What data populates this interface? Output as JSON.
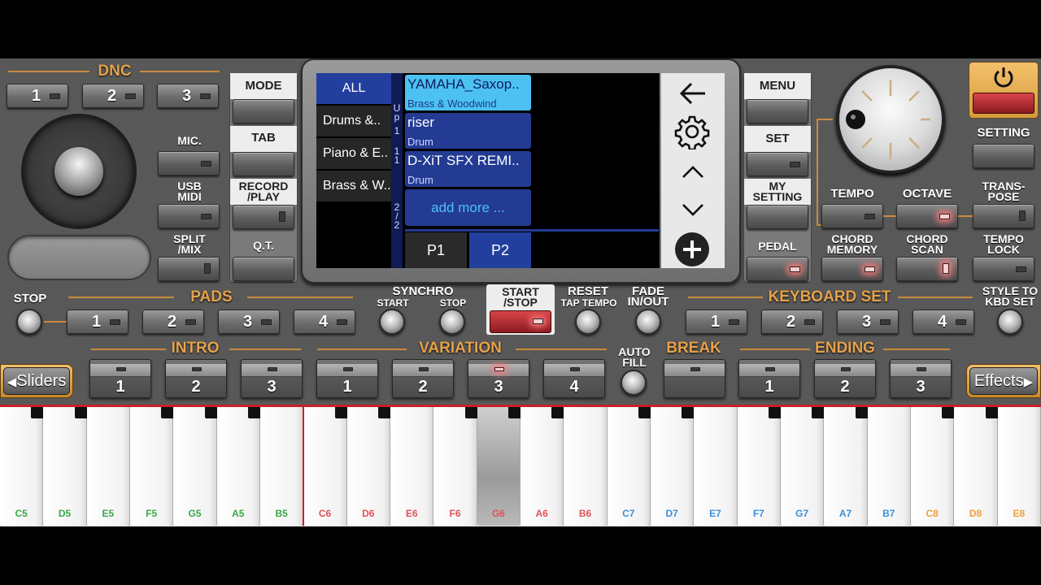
{
  "labels": {
    "dnc": "DNC",
    "mode": "MODE",
    "tab": "TAB",
    "record_play": "RECORD\n/PLAY",
    "qt": "Q.T.",
    "mic": "MIC.",
    "usb_midi": "USB\nMIDI",
    "split_mix": "SPLIT\n/MIX",
    "menu": "MENU",
    "set": "SET",
    "my_setting": "MY\nSETTING",
    "pedal": "PEDAL",
    "setting": "SETTING",
    "tempo": "TEMPO",
    "octave": "OCTAVE",
    "transpose": "TRANS-\nPOSE",
    "chord_memory": "CHORD\nMEMORY",
    "chord_scan": "CHORD\nSCAN",
    "tempo_lock": "TEMPO\nLOCK",
    "stop": "STOP",
    "pads": "PADS",
    "synchro": "SYNCHRO",
    "start": "START",
    "synchro_stop": "STOP",
    "start_stop": "START\n/STOP",
    "reset": "RESET",
    "tap_tempo": "TAP TEMPO",
    "fade": "FADE\nIN/OUT",
    "keyboard_set": "KEYBOARD SET",
    "style_to_kbd": "STYLE TO\nKBD SET",
    "intro": "INTRO",
    "variation": "VARIATION",
    "auto_fill": "AUTO\nFILL",
    "break": "BREAK",
    "ending": "ENDING",
    "sliders": "Sliders",
    "effects": "Effects"
  },
  "dnc_buttons": [
    "1",
    "2",
    "3"
  ],
  "pads": [
    "1",
    "2",
    "3",
    "4"
  ],
  "keyboard_set": [
    "1",
    "2",
    "3",
    "4"
  ],
  "intro": [
    "1",
    "2",
    "3"
  ],
  "variation": [
    "1",
    "2",
    "3",
    "4"
  ],
  "ending": [
    "1",
    "2",
    "3"
  ],
  "screen": {
    "categories": [
      "ALL",
      "Drums &..",
      "Piano & E..",
      "Brass & W.."
    ],
    "instruments": [
      {
        "name": "YAMAHA_Saxop..",
        "type": "Brass & Woodwind"
      },
      {
        "name": "riser",
        "type": "Drum"
      },
      {
        "name": "D-XiT SFX REMI..",
        "type": "Drum"
      }
    ],
    "add_more": "add more ...",
    "pages": [
      "P1",
      "P2"
    ],
    "upper_ind": [
      "U",
      "p",
      "1",
      "1",
      "1"
    ],
    "page_ind": [
      "2",
      "/",
      "2"
    ]
  },
  "keys": [
    "C5",
    "D5",
    "E5",
    "F5",
    "G5",
    "A5",
    "B5",
    "C6",
    "D6",
    "E6",
    "F6",
    "G6",
    "A6",
    "B6",
    "C7",
    "D7",
    "E7",
    "F7",
    "G7",
    "A7",
    "B7",
    "C8",
    "D8",
    "E8"
  ],
  "colors": {
    "accent": "#e7a24a",
    "screen_sel": "#4cc1f2",
    "screen_item": "#233b93"
  }
}
